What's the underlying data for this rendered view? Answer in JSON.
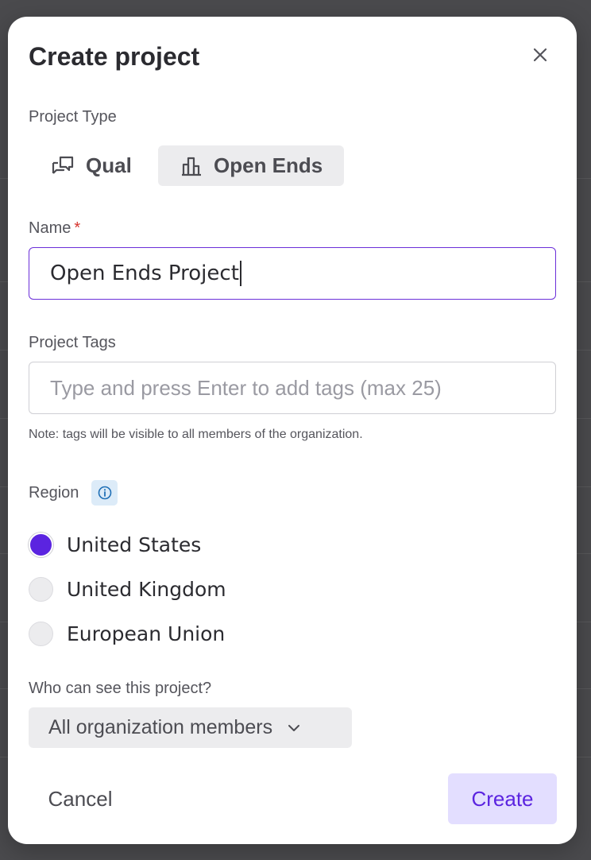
{
  "dialog": {
    "title": "Create project"
  },
  "project_type": {
    "label": "Project Type",
    "options": [
      {
        "label": "Qual",
        "icon": "chat-bubbles-icon"
      },
      {
        "label": "Open Ends",
        "icon": "bar-chart-icon",
        "selected": true
      }
    ]
  },
  "name_field": {
    "label": "Name",
    "required_marker": "*",
    "value": "Open Ends Project"
  },
  "tags_field": {
    "label": "Project Tags",
    "placeholder": "Type and press Enter to add tags (max 25)",
    "note": "Note: tags will be visible to all members of the organization."
  },
  "region": {
    "label": "Region",
    "info_icon": "info-icon",
    "options": [
      {
        "label": "United States",
        "checked": true
      },
      {
        "label": "United Kingdom",
        "checked": false
      },
      {
        "label": "European Union",
        "checked": false
      }
    ]
  },
  "visibility": {
    "label": "Who can see this project?",
    "selected": "All organization members"
  },
  "footer": {
    "cancel_label": "Cancel",
    "create_label": "Create"
  },
  "colors": {
    "accent": "#5b24e0",
    "accent_light": "#e3deff",
    "required": "#d6332d",
    "info_bg": "#dcebf8"
  }
}
